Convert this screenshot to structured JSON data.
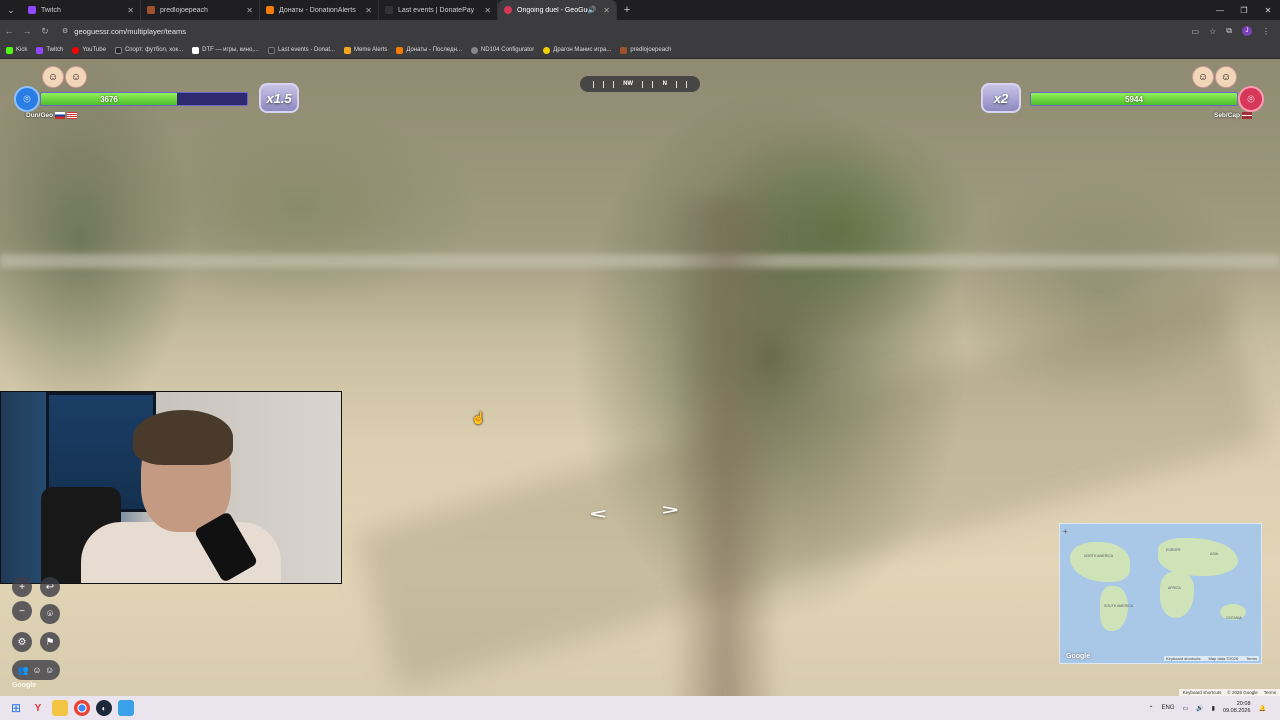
{
  "browser": {
    "tabs": [
      {
        "label": "Twitch",
        "color": "#9146ff",
        "active": false
      },
      {
        "label": "predlojoepeach",
        "color": "#a0522d",
        "active": false
      },
      {
        "label": "Донаты - DonationAlerts",
        "color": "#f57c00",
        "active": false
      },
      {
        "label": "Last events | DonatePay",
        "color": "#333333",
        "active": false
      },
      {
        "label": "Ongoing duel - GeoGuessr",
        "color": "#d7385a",
        "active": true
      }
    ],
    "url": "geoguessr.com/multiplayer/teams",
    "bookmarks": [
      {
        "label": "Kick",
        "color": "#53fc18"
      },
      {
        "label": "Twitch",
        "color": "#9146ff"
      },
      {
        "label": "YouTube",
        "color": "#ff0000"
      },
      {
        "label": "Спорт: футбол, хок...",
        "color": "#222222"
      },
      {
        "label": "DTF — игры, кино,...",
        "color": "#ffffff"
      },
      {
        "label": "Last events - Donat...",
        "color": "#333333"
      },
      {
        "label": "Meme Alerts",
        "color": "#f5a623"
      },
      {
        "label": "Донаты - Последн...",
        "color": "#f57c00"
      },
      {
        "label": "ND104 Configurator",
        "color": "#888888"
      },
      {
        "label": "Драгон Манис игра...",
        "color": "#f5d000"
      },
      {
        "label": "predlojoepeach",
        "color": "#a0522d"
      }
    ],
    "profile_initial": "J"
  },
  "game": {
    "left_team": {
      "health": "3676",
      "health_fraction": 0.66,
      "name": "Dun/Geo",
      "multiplier": "x1.5",
      "pin_color": "#2b7de6"
    },
    "right_team": {
      "health": "5944",
      "health_fraction": 1.0,
      "name": "Seb/Cap",
      "multiplier": "x2",
      "pin_color": "#d7385a"
    },
    "compass": {
      "left": "NW",
      "right": "N"
    },
    "arrows": {
      "back": "<",
      "forward": ">"
    },
    "google_label": "Google"
  },
  "minimap": {
    "zoom": "+",
    "google_label": "Google",
    "attribution": [
      "Keyboard shortcuts",
      "Map data ©2026",
      "Terms"
    ],
    "labels": [
      "NORTH AMERICA",
      "SOUTH AMERICA",
      "EUROPE",
      "AFRICA",
      "ASIA",
      "OCEANIA"
    ]
  },
  "page_attribution": [
    "Keyboard shortcuts",
    "© 2026 Google",
    "Terms"
  ],
  "taskbar": {
    "lang": "ENG",
    "time": "20:08",
    "date": "09.08.2026"
  }
}
